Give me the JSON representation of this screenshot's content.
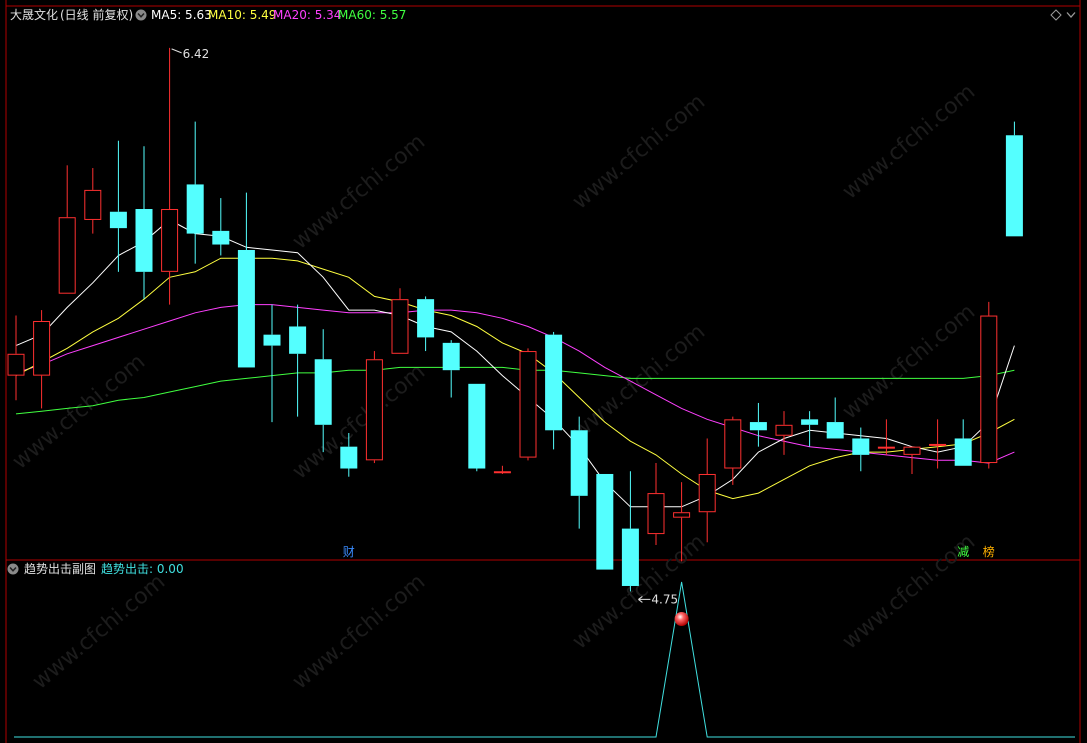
{
  "main_panel": {
    "stock_name": "大晟文化",
    "period_label": "(日线 前复权)",
    "ma_labels": [
      {
        "label": "MA5: 5.63",
        "color": "#ffffff"
      },
      {
        "label": "MA10: 5.49",
        "color": "#ffff40"
      },
      {
        "label": "MA20: 5.34",
        "color": "#ff40ff"
      },
      {
        "label": "MA60: 5.57",
        "color": "#40ff40"
      }
    ],
    "high_marker": "6.42",
    "low_marker": "4.75",
    "event_marks": [
      {
        "label": "财",
        "color": "#3a8cff",
        "index": 13
      },
      {
        "label": "减",
        "color": "#40ff40",
        "index": 37
      },
      {
        "label": "榜",
        "color": "#ffb000",
        "index": 38
      }
    ]
  },
  "sub_panel": {
    "title": "趋势出击副图",
    "value_label": "趋势出击: 0.00",
    "signal_index": 26
  },
  "watermark": "www.cfchi.com",
  "colors": {
    "up": "#ff3030",
    "down": "#54ffff",
    "frame": "#b00000",
    "signal_line": "#40e0e0"
  },
  "chart_data": {
    "type": "candlestick",
    "ylim": [
      4.6,
      6.5
    ],
    "candles": [
      {
        "o": 5.22,
        "h": 5.44,
        "l": 5.13,
        "c": 5.3
      },
      {
        "o": 5.22,
        "h": 5.46,
        "l": 5.1,
        "c": 5.42
      },
      {
        "o": 5.52,
        "h": 5.99,
        "l": 5.52,
        "c": 5.8
      },
      {
        "o": 5.79,
        "h": 5.98,
        "l": 5.74,
        "c": 5.9
      },
      {
        "o": 5.82,
        "h": 6.08,
        "l": 5.6,
        "c": 5.76
      },
      {
        "o": 5.83,
        "h": 6.06,
        "l": 5.5,
        "c": 5.6
      },
      {
        "o": 5.6,
        "h": 6.42,
        "l": 5.48,
        "c": 5.83
      },
      {
        "o": 5.92,
        "h": 6.15,
        "l": 5.63,
        "c": 5.74
      },
      {
        "o": 5.75,
        "h": 5.87,
        "l": 5.66,
        "c": 5.7
      },
      {
        "o": 5.68,
        "h": 5.89,
        "l": 5.25,
        "c": 5.25
      },
      {
        "o": 5.37,
        "h": 5.48,
        "l": 5.05,
        "c": 5.33
      },
      {
        "o": 5.4,
        "h": 5.48,
        "l": 5.07,
        "c": 5.3
      },
      {
        "o": 5.28,
        "h": 5.39,
        "l": 4.94,
        "c": 5.04
      },
      {
        "o": 4.96,
        "h": 5.01,
        "l": 4.85,
        "c": 4.88
      },
      {
        "o": 4.91,
        "h": 5.31,
        "l": 4.9,
        "c": 5.28
      },
      {
        "o": 5.3,
        "h": 5.54,
        "l": 5.3,
        "c": 5.5
      },
      {
        "o": 5.5,
        "h": 5.51,
        "l": 5.31,
        "c": 5.36
      },
      {
        "o": 5.34,
        "h": 5.35,
        "l": 5.14,
        "c": 5.24
      },
      {
        "o": 5.19,
        "h": 5.19,
        "l": 4.87,
        "c": 4.88
      },
      {
        "o": 4.87,
        "h": 4.89,
        "l": 4.86,
        "c": 4.87
      },
      {
        "o": 4.92,
        "h": 5.32,
        "l": 4.91,
        "c": 5.31
      },
      {
        "o": 5.37,
        "h": 5.38,
        "l": 4.95,
        "c": 5.02
      },
      {
        "o": 5.02,
        "h": 5.07,
        "l": 4.66,
        "c": 4.78
      },
      {
        "o": 4.86,
        "h": 4.86,
        "l": 4.51,
        "c": 4.51
      },
      {
        "o": 4.66,
        "h": 4.87,
        "l": 4.43,
        "c": 4.45
      },
      {
        "o": 4.64,
        "h": 4.9,
        "l": 4.6,
        "c": 4.79
      },
      {
        "o": 4.7,
        "h": 4.83,
        "l": 4.54,
        "c": 4.72
      },
      {
        "o": 4.72,
        "h": 4.99,
        "l": 4.61,
        "c": 4.86
      },
      {
        "o": 4.88,
        "h": 5.07,
        "l": 4.82,
        "c": 5.06
      },
      {
        "o": 5.05,
        "h": 5.12,
        "l": 4.96,
        "c": 5.02
      },
      {
        "o": 5.0,
        "h": 5.09,
        "l": 4.93,
        "c": 5.04
      },
      {
        "o": 5.06,
        "h": 5.09,
        "l": 4.96,
        "c": 5.04
      },
      {
        "o": 5.05,
        "h": 5.14,
        "l": 4.99,
        "c": 4.99
      },
      {
        "o": 4.99,
        "h": 5.03,
        "l": 4.87,
        "c": 4.93
      },
      {
        "o": 4.96,
        "h": 5.06,
        "l": 4.93,
        "c": 4.96
      },
      {
        "o": 4.93,
        "h": 4.94,
        "l": 4.86,
        "c": 4.96
      },
      {
        "o": 4.97,
        "h": 5.06,
        "l": 4.88,
        "c": 4.97
      },
      {
        "o": 4.99,
        "h": 5.06,
        "l": 4.89,
        "c": 4.89
      },
      {
        "o": 4.9,
        "h": 5.49,
        "l": 4.88,
        "c": 5.44
      },
      {
        "o": 6.1,
        "h": 6.15,
        "l": 5.73,
        "c": 5.73
      }
    ],
    "ma_lines": {
      "MA5": [
        5.33,
        5.37,
        5.47,
        5.56,
        5.66,
        5.71,
        5.79,
        5.74,
        5.73,
        5.69,
        5.68,
        5.67,
        5.58,
        5.46,
        5.46,
        5.44,
        5.4,
        5.38,
        5.31,
        5.22,
        5.14,
        5.06,
        4.96,
        4.83,
        4.74,
        4.74,
        4.74,
        4.78,
        4.84,
        4.94,
        4.99,
        5.02,
        5.01,
        5.0,
        4.99,
        4.96,
        4.94,
        4.96,
        5.05,
        5.33
      ],
      "MA10": [
        5.22,
        5.27,
        5.32,
        5.38,
        5.43,
        5.5,
        5.58,
        5.6,
        5.65,
        5.65,
        5.65,
        5.64,
        5.61,
        5.58,
        5.51,
        5.49,
        5.46,
        5.44,
        5.4,
        5.34,
        5.3,
        5.23,
        5.14,
        5.05,
        4.98,
        4.93,
        4.86,
        4.8,
        4.77,
        4.79,
        4.84,
        4.89,
        4.92,
        4.94,
        4.94,
        4.95,
        4.96,
        4.97,
        5.01,
        5.06
      ],
      "MA20": [
        5.23,
        5.26,
        5.3,
        5.33,
        5.36,
        5.39,
        5.42,
        5.45,
        5.47,
        5.48,
        5.48,
        5.47,
        5.46,
        5.45,
        5.45,
        5.45,
        5.46,
        5.46,
        5.45,
        5.43,
        5.4,
        5.36,
        5.31,
        5.25,
        5.2,
        5.15,
        5.1,
        5.06,
        5.03,
        5.0,
        4.98,
        4.96,
        4.95,
        4.94,
        4.93,
        4.92,
        4.91,
        4.91,
        4.9,
        4.94
      ],
      "MA60": [
        5.08,
        5.09,
        5.1,
        5.11,
        5.13,
        5.14,
        5.16,
        5.18,
        5.2,
        5.21,
        5.22,
        5.23,
        5.23,
        5.24,
        5.24,
        5.25,
        5.25,
        5.25,
        5.25,
        5.25,
        5.24,
        5.24,
        5.23,
        5.22,
        5.21,
        5.21,
        5.21,
        5.21,
        5.21,
        5.21,
        5.21,
        5.21,
        5.21,
        5.21,
        5.21,
        5.21,
        5.21,
        5.21,
        5.22,
        5.24
      ]
    },
    "ma_colors": {
      "MA5": "#ffffff",
      "MA10": "#ffff40",
      "MA20": "#ff40ff",
      "MA60": "#40ff40"
    },
    "signal_values": [
      0,
      0,
      0,
      0,
      0,
      0,
      0,
      0,
      0,
      0,
      0,
      0,
      0,
      0,
      0,
      0,
      0,
      0,
      0,
      0,
      0,
      0,
      0,
      0,
      0,
      0,
      1,
      0,
      0,
      0,
      0,
      0,
      0,
      0,
      0,
      0,
      0,
      0,
      0,
      0
    ]
  }
}
